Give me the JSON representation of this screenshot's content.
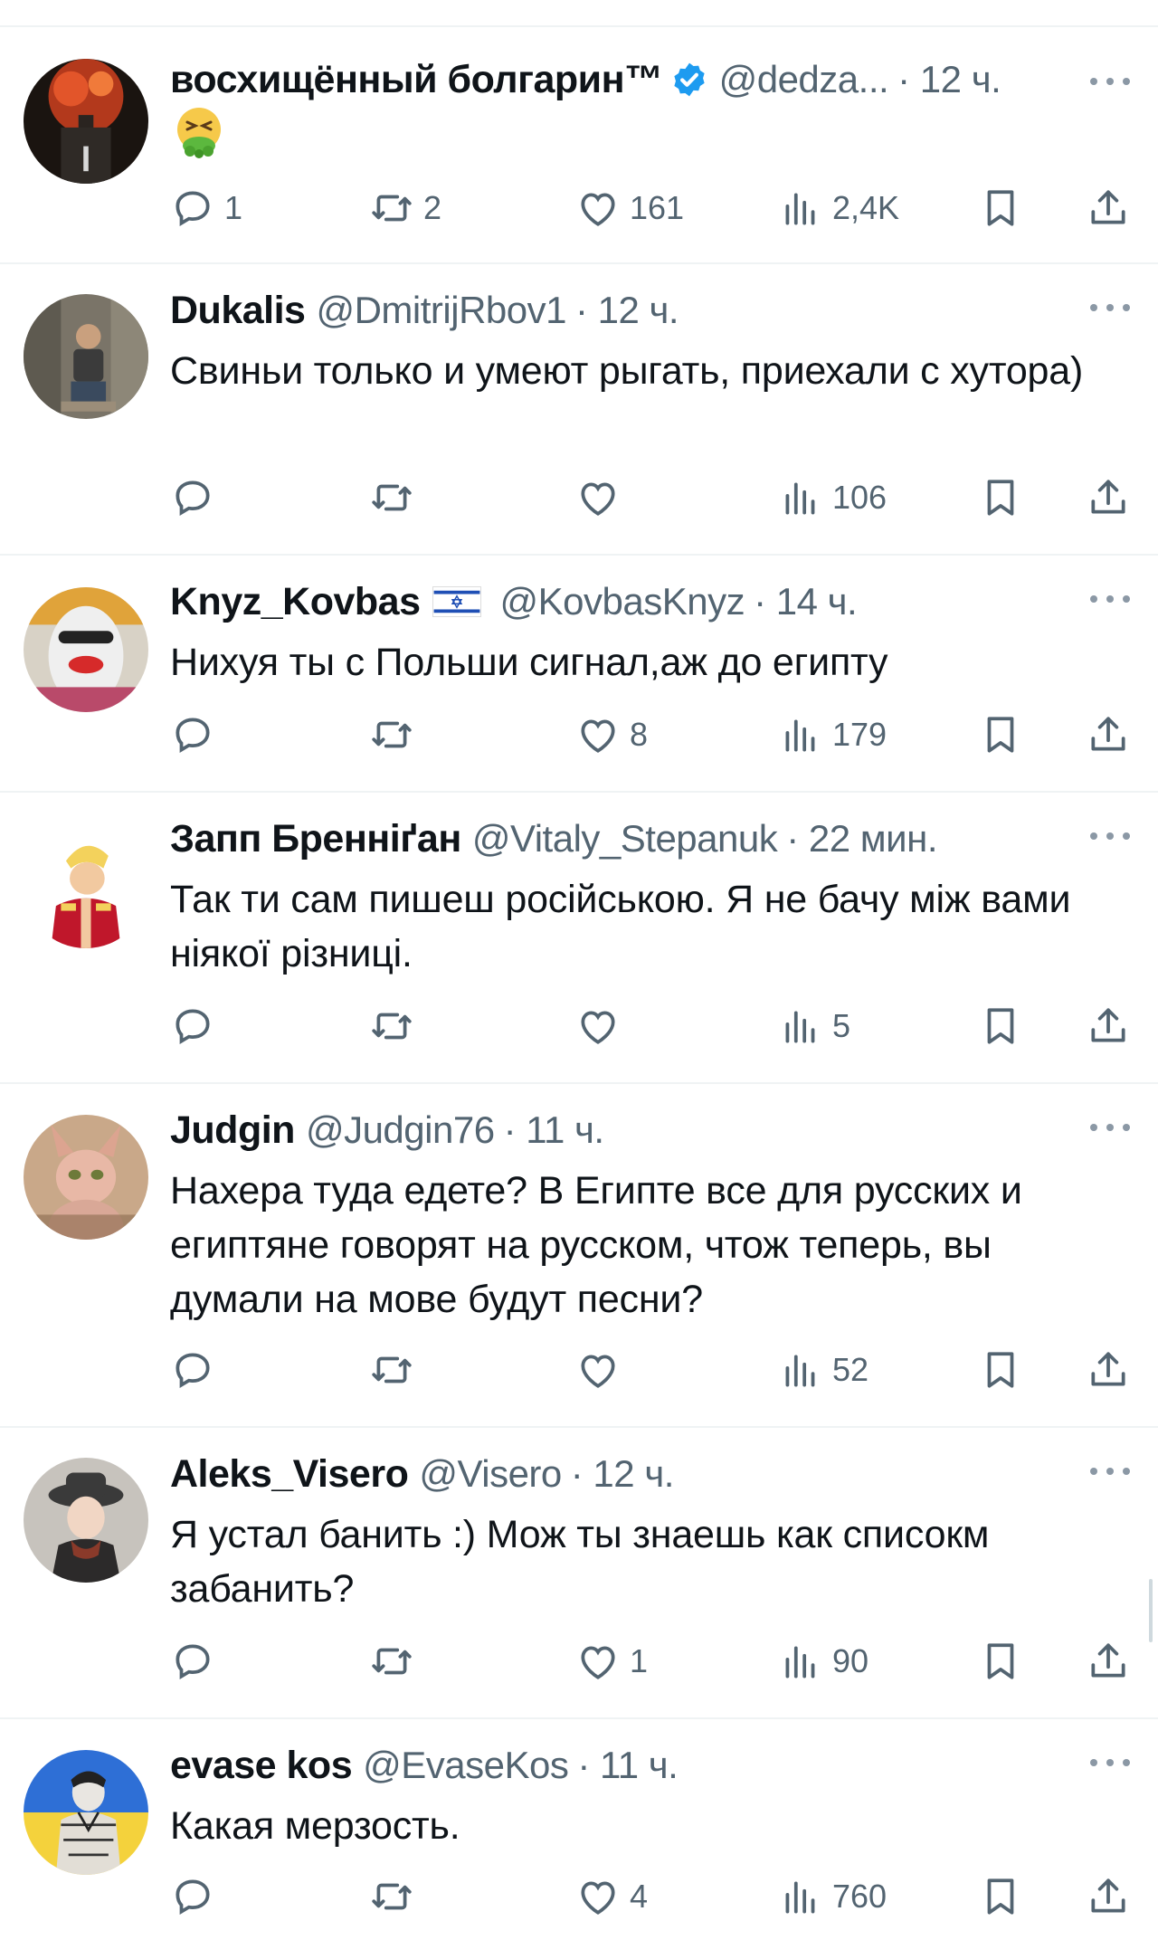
{
  "tweets": [
    {
      "name": "восхищённый болгарин™",
      "verified": true,
      "flag": false,
      "handle": "@dedza...",
      "time": "· 12 ч.",
      "text": "",
      "emoji": "nauseated-face-emoji",
      "replies": "1",
      "retweets": "2",
      "likes": "161",
      "views": "2,4K",
      "avatar": "dark-fire-avatar"
    },
    {
      "name": "Dukalis",
      "verified": false,
      "flag": false,
      "handle": "@DmitrijRbov1",
      "time": "· 12 ч.",
      "text": "Свиньи только и умеют рыгать, приехали с хутора)",
      "replies": "",
      "retweets": "",
      "likes": "",
      "views": "106",
      "avatar": "man-sitting-avatar"
    },
    {
      "name": "Knyz_Kovbas",
      "verified": false,
      "flag": true,
      "handle": "@KovbasKnyz",
      "time": "· 14 ч.",
      "text": "Нихуя ты с Польши сигнал,аж до египту",
      "replies": "",
      "retweets": "",
      "likes": "8",
      "views": "179",
      "avatar": "clown-face-avatar"
    },
    {
      "name": "Запп Бренніґан",
      "verified": false,
      "flag": false,
      "handle": "@Vitaly_Stepanuk",
      "time": "· 22 мин.",
      "text": "Так ти сам пишеш російською. Я не бачу між вами ніякої різниці.",
      "replies": "",
      "retweets": "",
      "likes": "",
      "views": "5",
      "avatar": "cartoon-captain-avatar"
    },
    {
      "name": "Judgin",
      "verified": false,
      "flag": false,
      "handle": "@Judgin76",
      "time": "· 11 ч.",
      "text": "Нахера туда едете? В Египте все для русских и египтяне говорят на русском, чтож теперь, вы думали на мове будут песни?",
      "replies": "",
      "retweets": "",
      "likes": "",
      "views": "52",
      "avatar": "sphynx-cat-avatar"
    },
    {
      "name": "Aleks_Visero",
      "verified": false,
      "flag": false,
      "handle": "@Visero",
      "time": "· 12 ч.",
      "text": "Я устал банить :) Мож ты знаешь как списокм забанить?",
      "replies": "",
      "retweets": "",
      "likes": "1",
      "views": "90",
      "avatar": "man-with-hat-avatar"
    },
    {
      "name": "evase kos",
      "verified": false,
      "flag": false,
      "handle": "@EvaseKos",
      "time": "· 11 ч.",
      "text": "Какая мерзость.",
      "replies": "",
      "retweets": "",
      "likes": "4",
      "views": "760",
      "avatar": "soldier-sketch-avatar"
    }
  ],
  "colors": {
    "text": "#0f1419",
    "muted": "#536471",
    "divider": "#eff3f4",
    "verified": "#1d9bf0"
  }
}
